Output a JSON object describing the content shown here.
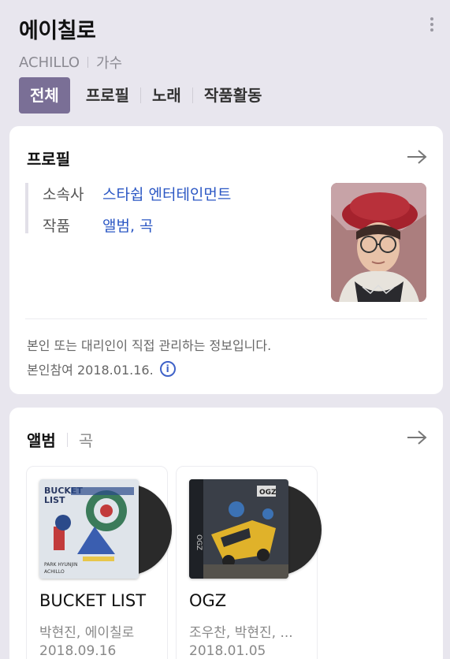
{
  "header": {
    "title": "에이칠로",
    "english_name": "ACHILLO",
    "role": "가수",
    "tabs": [
      "전체",
      "프로필",
      "노래",
      "작품활동"
    ]
  },
  "profile": {
    "title": "프로필",
    "agency_label": "소속사",
    "agency_value": "스타쉽 엔터테인먼트",
    "works_label": "작품",
    "works_value": "앨범, 곡",
    "note": "본인 또는 대리인이 직접 관리하는 정보입니다.",
    "participation": "본인참여 2018.01.16."
  },
  "albums_section": {
    "tab_album": "앨범",
    "tab_song": "곡",
    "albums": [
      {
        "title": "BUCKET LIST",
        "artists": "박현진, 에이칠로",
        "date": "2018.09.16",
        "cover_text": "BUCKET LIST"
      },
      {
        "title": "OGZ",
        "artists": "조우찬, 박현진, ...",
        "date": "2018.01.05",
        "cover_text": "OGZ"
      }
    ]
  },
  "colors": {
    "accent": "#7a6f96",
    "link": "#2b57c4",
    "background": "#e8e6ee"
  }
}
